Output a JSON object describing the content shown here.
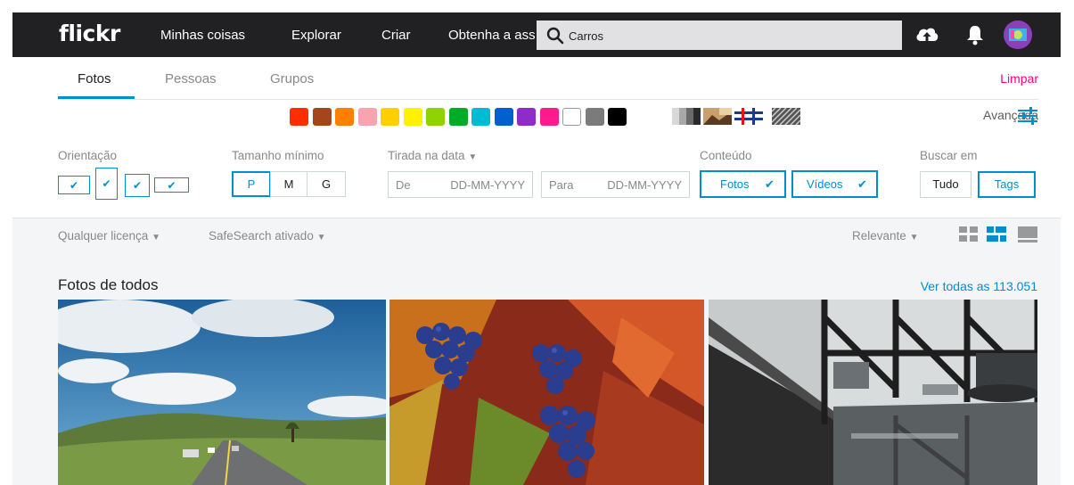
{
  "header": {
    "logo": "flickr",
    "nav": [
      "Minhas coisas",
      "Explorar",
      "Criar",
      "Obtenha a ass"
    ],
    "search_value": "Carros",
    "colors": {
      "bar": "#212124",
      "accent": "#008ecf",
      "pink": "#ff0084"
    }
  },
  "tabs": [
    {
      "label": "Fotos",
      "active": true
    },
    {
      "label": "Pessoas",
      "active": false
    },
    {
      "label": "Grupos",
      "active": false
    }
  ],
  "limpar_label": "Limpar",
  "colors_filter": [
    "#ff2d00",
    "#a5451c",
    "#ff7f00",
    "#f7a4b0",
    "#ffcf00",
    "#fff200",
    "#8fd300",
    "#00ab29",
    "#00bcd3",
    "#0061ce",
    "#8d2cc9",
    "#ff1b8d",
    "#ffffff",
    "#7b7b7b",
    "#000000"
  ],
  "style_filters": [
    "black-and-white-pattern",
    "shallow-depth-pattern",
    "minimalist-pattern",
    "texture-pattern"
  ],
  "advanced_label": "Avançada",
  "filters": {
    "orientation_label": "Orientação",
    "size_label": "Tamanho mínimo",
    "sizes": [
      {
        "label": "P",
        "active": true
      },
      {
        "label": "M",
        "active": false
      },
      {
        "label": "G",
        "active": false
      }
    ],
    "date_label": "Tirada na data",
    "date_from_label": "De",
    "date_from_placeholder": "DD-MM-YYYY",
    "date_to_label": "Para",
    "date_to_placeholder": "DD-MM-YYYY",
    "content_label": "Conteúdo",
    "content_photos": "Fotos",
    "content_videos": "Vídeos",
    "search_in_label": "Buscar em",
    "search_in_all": "Tudo",
    "search_in_tags": "Tags"
  },
  "subfilters": {
    "license": "Qualquer licença",
    "safesearch": "SafeSearch ativado",
    "sort": "Relevante"
  },
  "section": {
    "title": "Fotos de todos",
    "view_all": "Ver todas as 113.051"
  },
  "photos": [
    {
      "name": "road-landscape-photo"
    },
    {
      "name": "grapes-leaves-photo"
    },
    {
      "name": "bridge-reflection-photo"
    }
  ]
}
